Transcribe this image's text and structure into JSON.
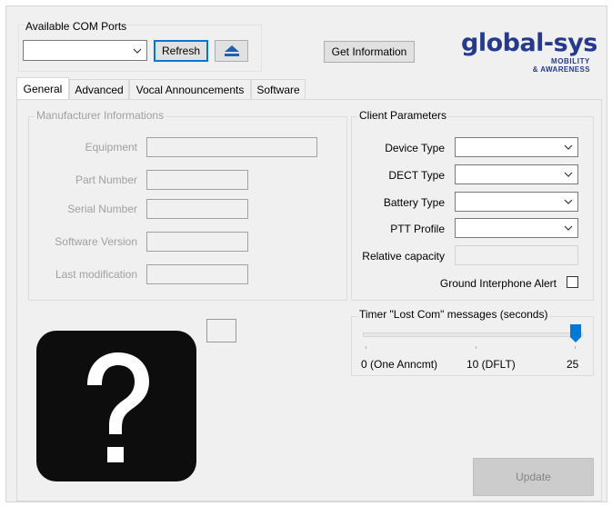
{
  "com_ports": {
    "title": "Available COM Ports",
    "selected": "",
    "refresh_label": "Refresh",
    "eject_icon": "eject-icon"
  },
  "get_info_label": "Get Information",
  "logo": {
    "brand": "global-sys",
    "tagline_1": "MOBILITY",
    "tagline_2": "& AWARENESS",
    "color": "#253a8c"
  },
  "tabs": [
    {
      "label": "General",
      "active": true
    },
    {
      "label": "Advanced",
      "active": false
    },
    {
      "label": "Vocal Announcements",
      "active": false
    },
    {
      "label": "Software",
      "active": false
    }
  ],
  "manufacturer": {
    "title": "Manufacturer Informations",
    "fields": [
      {
        "label": "Equipment",
        "value": ""
      },
      {
        "label": "Part Number",
        "value": ""
      },
      {
        "label": "Serial Number",
        "value": ""
      },
      {
        "label": "Software Version",
        "value": ""
      },
      {
        "label": "Last modification",
        "value": ""
      }
    ]
  },
  "client": {
    "title": "Client Parameters",
    "fields": [
      {
        "label": "Device Type",
        "value": ""
      },
      {
        "label": "DECT Type",
        "value": ""
      },
      {
        "label": "Battery Type",
        "value": ""
      },
      {
        "label": "PTT Profile",
        "value": ""
      },
      {
        "label": "Relative capacity",
        "value": ""
      }
    ],
    "ground_alert_label": "Ground Interphone Alert",
    "ground_alert_checked": false
  },
  "timer": {
    "title": "Timer \"Lost Com\" messages (seconds)",
    "min_label": "0 (One Anncmt)",
    "mid_label": "10 (DFLT)",
    "max_label": "25",
    "min": 0,
    "default": 10,
    "max": 25,
    "value": 25
  },
  "device_image_icon": "question-mark-icon",
  "update_label": "Update",
  "colors": {
    "focus_blue": "#0078d7",
    "slider_thumb": "#0078d7",
    "logo_blue": "#253a8c"
  }
}
